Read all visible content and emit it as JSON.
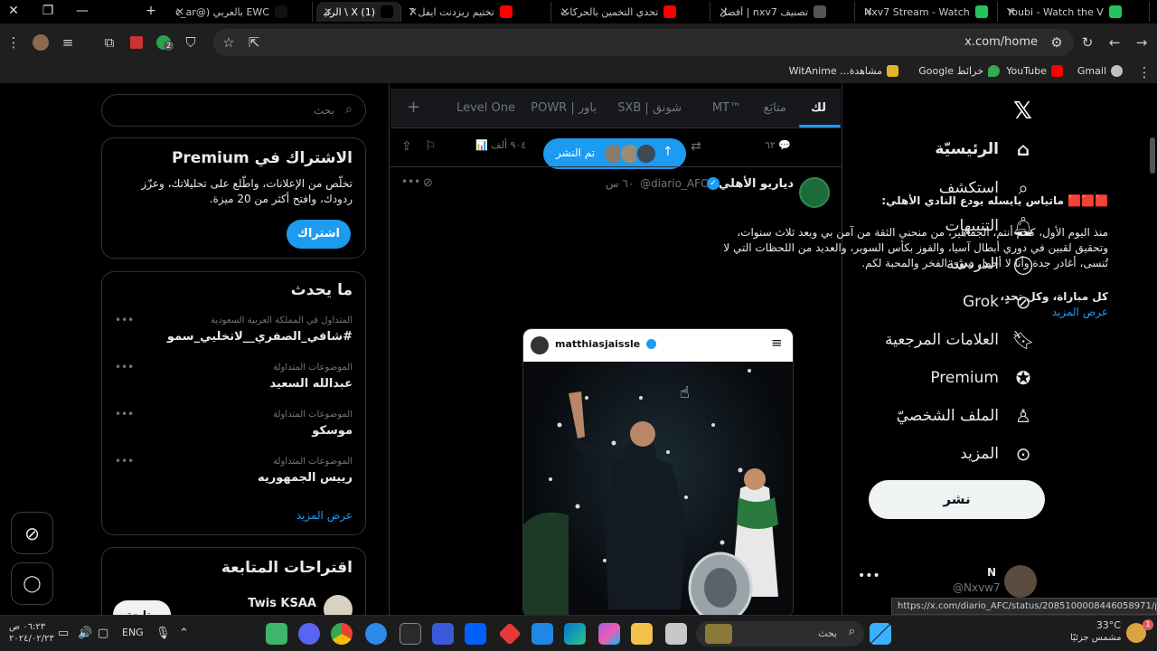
{
  "browser": {
    "tabs": [
      {
        "title": "Youbi - Watch the V",
        "fav_color": "#20c55b",
        "fav_icon": "kick-icon"
      },
      {
        "title": "Nxv7 Stream - Watch",
        "fav_color": "#20c55b",
        "fav_icon": "kick-icon"
      },
      {
        "title": "تصنيف nxv7 | أفضل",
        "fav_color": "#555555",
        "fav_icon": "diamond-icon"
      },
      {
        "title": "تحدي التخمين بالحركات",
        "fav_color": "#ff0000",
        "fav_icon": "youtube-icon"
      },
      {
        "title": "تختيم ريزدنت ايفل 7",
        "fav_color": "#ff0000",
        "fav_icon": "youtube-icon"
      },
      {
        "title": "(1) X \\ الرئيسية",
        "fav_color": "#000000",
        "fav_icon": "x-icon"
      },
      {
        "title": "EWC بالعربي (@c_ar",
        "fav_color": "#111111",
        "fav_icon": "tiktok-icon"
      }
    ],
    "url": "x.com/home",
    "bookmarks": [
      "Gmail",
      "YouTube",
      "خرائط Google",
      "مشاهدة... WitAnime"
    ],
    "extension_badge": "2",
    "status_url": "https://x.com/diario_AFC/status/2085100008446058971/photo/1"
  },
  "nav": {
    "items": [
      {
        "label": "الرئيسيّة",
        "icon": "home-icon"
      },
      {
        "label": "استكشف",
        "icon": "search-icon"
      },
      {
        "label": "التنبيهات",
        "icon": "bell-icon"
      },
      {
        "label": "الدردشة",
        "icon": "chat-icon"
      },
      {
        "label": "Grok",
        "icon": "grok-icon"
      },
      {
        "label": "العلامات المرجعية",
        "icon": "bookmark-icon"
      },
      {
        "label": "Premium",
        "icon": "verified-icon"
      },
      {
        "label": "الملف الشخصيّ",
        "icon": "person-icon"
      },
      {
        "label": "المزيد",
        "icon": "more-circle-icon"
      }
    ],
    "post_label": "نشر",
    "account": {
      "name": "N",
      "handle": "@Nxvw7"
    }
  },
  "feed": {
    "tabs": [
      "لك",
      "متابَع",
      "MT™",
      "SXB | شونق",
      "POWR | باور",
      "Level One"
    ],
    "actions": {
      "replies": "٦٢",
      "views": "٩٠٤ ألف"
    },
    "posted_pill": "تم النشر"
  },
  "tweet": {
    "name": "دياريو الأهلي",
    "handle": "@diario_AFC",
    "time": "٦٠ س",
    "headline": "🟥🟥🟥 ماتياس يايسله يودع النادي الأهلي:",
    "body": "منذ اليوم الأول، كنتم أنتم، الجماهير، من منحني الثقة من آمن بي وبعد ثلاث سنوات، وتحقيق لقبين في دوري أبطال آسيا، والفوز بكأس السوبر، والعديد من اللحظات التي لا تُنسى، أغادر جدة وأنا لا أحمل سوى الفخر والمحبة لكم.",
    "body2": "كل مباراة، وكل تحدٍ،",
    "show_more": "عرض المزيد",
    "card_user": "matthiasjaissle"
  },
  "sidebar": {
    "search_placeholder": "بحث",
    "premium": {
      "title": "الاشتراك في Premium",
      "text": "تخلّص من الإعلانات، واطّلع على تحليلاتك، وعزّز ردودك، وافتح أكثر من 20 ميزة.",
      "button": "اشتراك"
    },
    "trends_title": "ما يحدث",
    "trends": [
      {
        "meta": "المتداول في المملكة العربية السعودية",
        "name": "#شافي_الصفري__لاتخليي_سمو"
      },
      {
        "meta": "الموضوعات المتداولة",
        "name": "عبدالله السعيد"
      },
      {
        "meta": "الموضوعات المتداولة",
        "name": "موسكو"
      },
      {
        "meta": "الموضوعات المتداولة",
        "name": "رييس الجمهوريه"
      }
    ],
    "trends_more": "عرض المزيد",
    "follow_title": "اقتراحات المتابعة",
    "follow_name": "Twis KSAA",
    "follow_button": "متابعة"
  },
  "taskbar": {
    "search": "بحث",
    "lang": "ENG",
    "time": "٠٦:٢٣ ص",
    "date": "٢٠٢٤/٠٢/٢٣",
    "weather_temp": "33°C",
    "weather_desc": "مشمس جزئيًا"
  }
}
